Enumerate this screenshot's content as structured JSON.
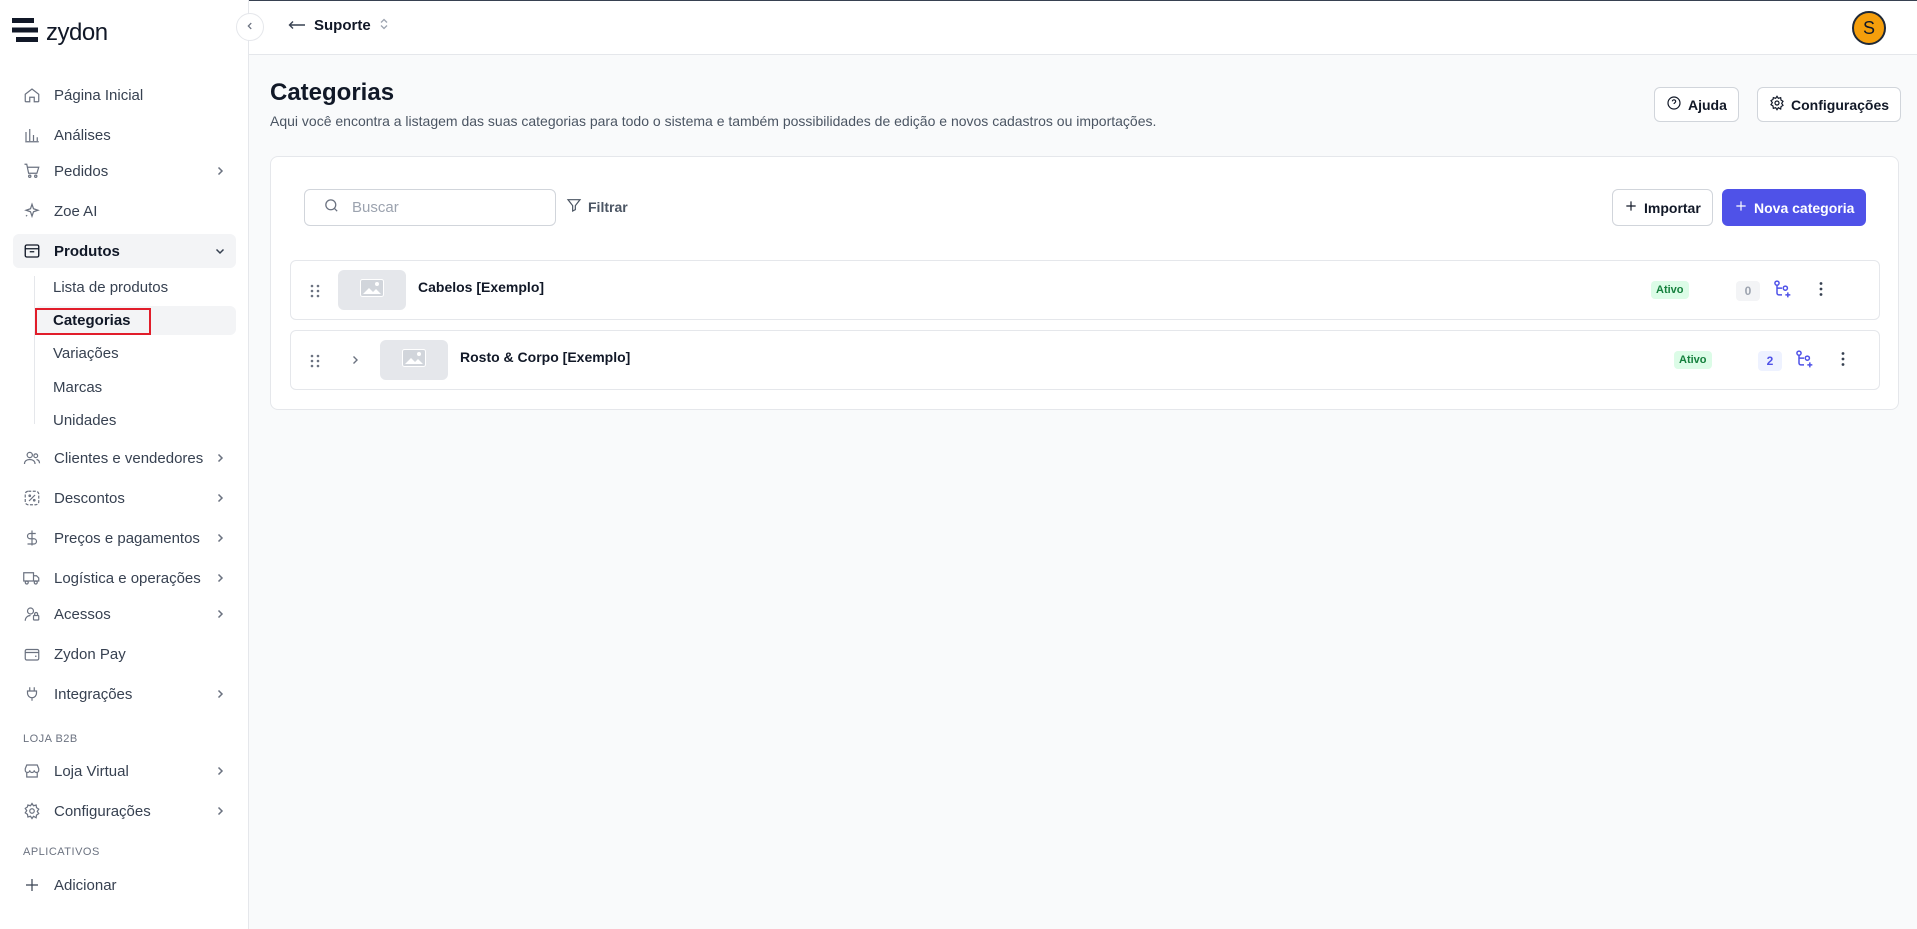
{
  "brand": {
    "name": "zydon"
  },
  "sidebar": {
    "items": [
      {
        "label": "Página Inicial",
        "icon": "home-icon"
      },
      {
        "label": "Análises",
        "icon": "chart-icon"
      },
      {
        "label": "Pedidos",
        "icon": "cart-icon"
      },
      {
        "label": "Zoe AI",
        "icon": "sparkle-icon"
      },
      {
        "label": "Produtos",
        "icon": "box-icon"
      },
      {
        "label": "Clientes e vendedores",
        "icon": "users-icon"
      },
      {
        "label": "Descontos",
        "icon": "discount-icon"
      },
      {
        "label": "Preços e pagamentos",
        "icon": "dollar-icon"
      },
      {
        "label": "Logística e operações",
        "icon": "truck-icon"
      },
      {
        "label": "Acessos",
        "icon": "access-icon"
      },
      {
        "label": "Zydon Pay",
        "icon": "wallet-icon"
      },
      {
        "label": "Integrações",
        "icon": "plug-icon"
      },
      {
        "label": "Loja Virtual",
        "icon": "store-icon"
      },
      {
        "label": "Configurações",
        "icon": "gear-icon"
      },
      {
        "label": "Adicionar",
        "icon": "plus-icon"
      }
    ],
    "produtos_sub": [
      {
        "label": "Lista de produtos"
      },
      {
        "label": "Categorias"
      },
      {
        "label": "Variações"
      },
      {
        "label": "Marcas"
      },
      {
        "label": "Unidades"
      }
    ],
    "section_b2b": "LOJA B2B",
    "section_apps": "APLICATIVOS"
  },
  "topbar": {
    "workspace": "Suporte",
    "avatar_initial": "S"
  },
  "page": {
    "title": "Categorias",
    "subtitle": "Aqui você encontra a listagem das suas categorias para todo o sistema e também possibilidades de edição e novos cadastros ou importações.",
    "help_label": "Ajuda",
    "settings_label": "Configurações"
  },
  "toolbar": {
    "search_placeholder": "Buscar",
    "filter_label": "Filtrar",
    "import_label": "Importar",
    "new_label": "Nova categoria"
  },
  "categories": [
    {
      "name": "Cabelos [Exemplo]",
      "status": "Ativo",
      "count": "0",
      "expandable": false
    },
    {
      "name": "Rosto & Corpo [Exemplo]",
      "status": "Ativo",
      "count": "2",
      "expandable": true
    }
  ],
  "colors": {
    "accent": "#4f52e8",
    "active_green": "#15803d",
    "highlight_red": "#e11d2a",
    "avatar": "#f59e0b"
  }
}
